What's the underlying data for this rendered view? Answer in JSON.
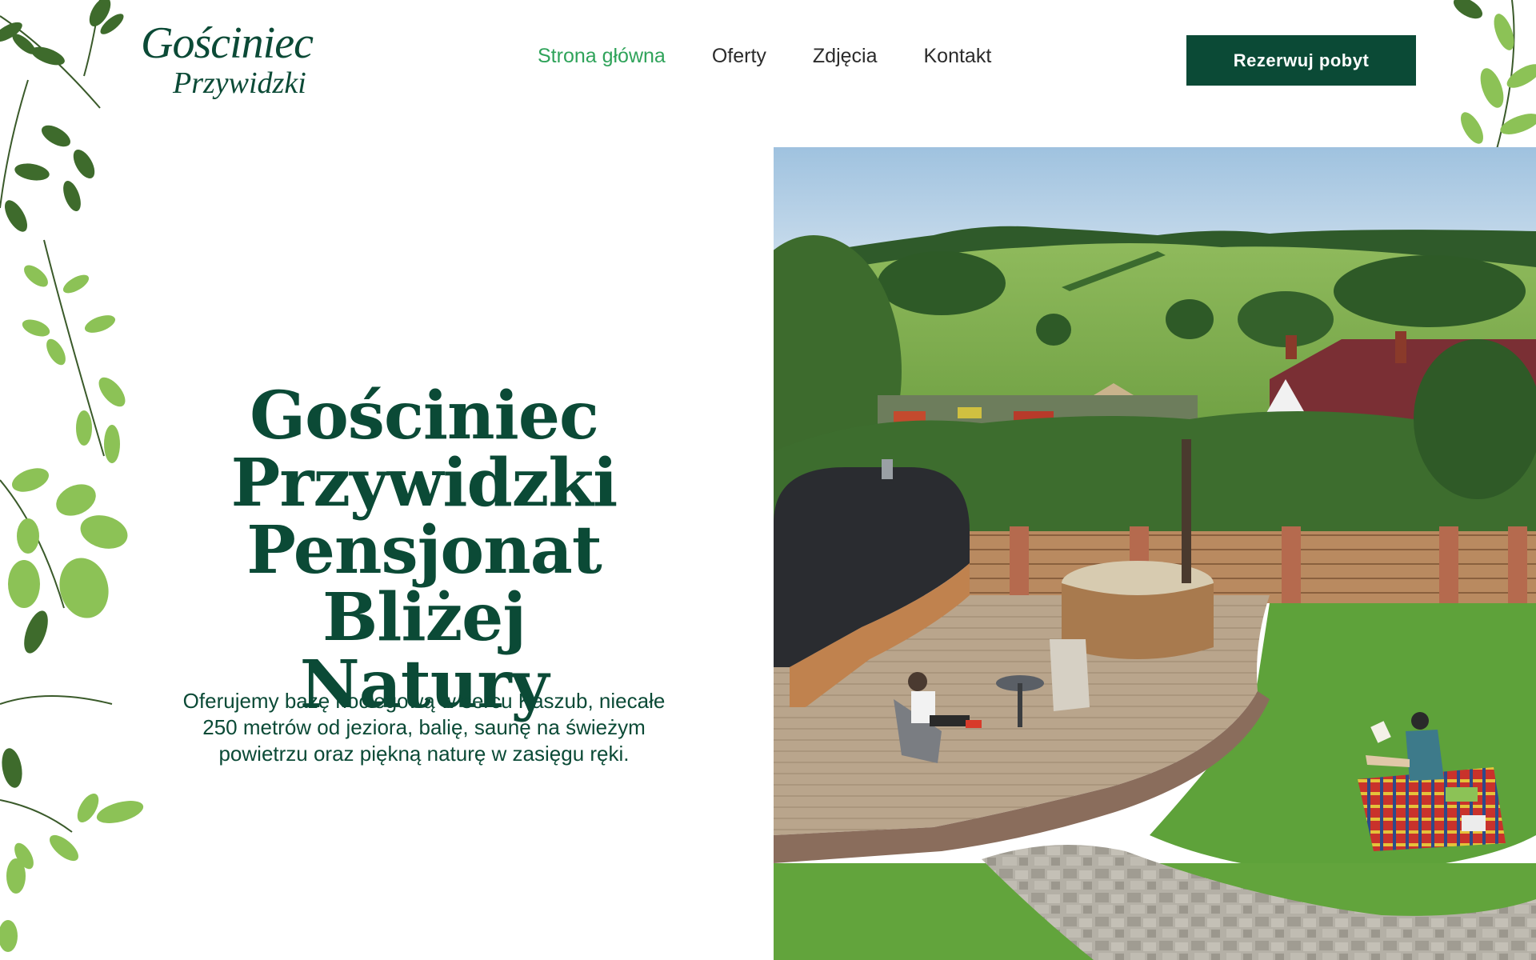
{
  "header": {
    "logo": {
      "line1": "Gościniec",
      "line2": "Przywidzki"
    },
    "nav": [
      {
        "label": "Strona główna",
        "active": true
      },
      {
        "label": "Oferty",
        "active": false
      },
      {
        "label": "Zdjęcia",
        "active": false
      },
      {
        "label": "Kontakt",
        "active": false
      }
    ],
    "cta_label": "Rezerwuj pobyt"
  },
  "hero": {
    "title_lines": [
      "Gościniec",
      "Przywidzki",
      "Pensjonat Bliżej",
      "Natury"
    ],
    "subtitle": "Oferujemy bazę noclegową w sercu Kaszub, niecałe 250 metrów od jeziora, balię, saunę na świeżym powietrzu oraz piękną naturę w zasięgu ręki."
  },
  "colors": {
    "brand_dark_green": "#0b4a36",
    "nav_active_green": "#2fa35a",
    "nav_text": "#2b2b2b"
  },
  "icons": {
    "foliage_left": "leaf-branch-decoration",
    "foliage_right": "leaf-branch-decoration"
  }
}
